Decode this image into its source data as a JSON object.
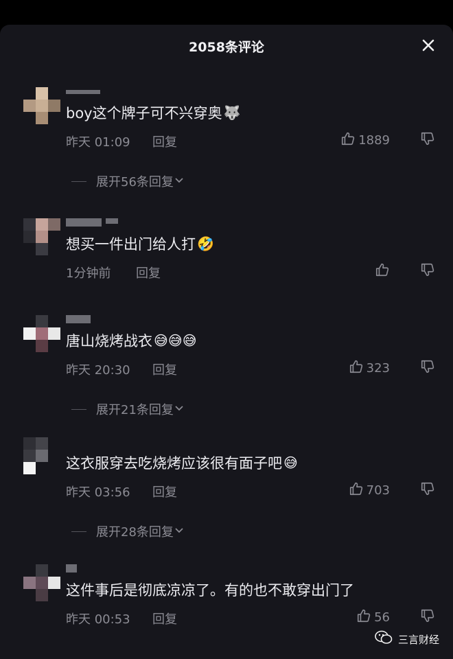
{
  "header": {
    "title": "2058条评论"
  },
  "comments": [
    {
      "text": "boy这个牌子可不兴穿奥",
      "emoji": "🐺",
      "time": "昨天 01:09",
      "reply": "回复",
      "likes": "1889",
      "expand": "展开56条回复"
    },
    {
      "text": "想买一件出门给人打",
      "emoji": "🤣",
      "time": "1分钟前",
      "reply": "回复",
      "likes": "",
      "expand": ""
    },
    {
      "text": "唐山烧烤战衣",
      "emoji": "😅😅😅",
      "time": "昨天 20:30",
      "reply": "回复",
      "likes": "323",
      "expand": "展开21条回复"
    },
    {
      "text": "这衣服穿去吃烧烤应该很有面子吧",
      "emoji": "😅",
      "time": "昨天 03:56",
      "reply": "回复",
      "likes": "703",
      "expand": "展开28条回复"
    },
    {
      "text": "这件事后是彻底凉凉了。有的也不敢穿出门了",
      "emoji": "",
      "time": "昨天 00:53",
      "reply": "回复",
      "likes": "56",
      "expand": ""
    }
  ],
  "watermark": {
    "label": "三言财经"
  },
  "colors": {
    "panel": "#16161c",
    "text": "#ececf0",
    "muted": "#8b8b93"
  }
}
